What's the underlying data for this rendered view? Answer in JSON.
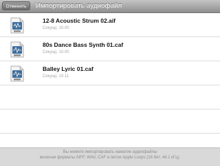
{
  "navbar": {
    "cancel_label": "Отменить",
    "title": "Импортировать аудиофайл"
  },
  "files": [
    {
      "name": "12-8 Acoustic Strum 02.aif",
      "subtitle": "Секунд: 10.00",
      "icon": "aif-file-icon"
    },
    {
      "name": "80s Dance Bass Synth 01.caf",
      "subtitle": "Секунд: 10.00",
      "icon": "caf-file-icon"
    },
    {
      "name": "Balley Lyric 01.caf",
      "subtitle": "Секунд: 10.11",
      "icon": "caf-file-icon"
    }
  ],
  "footer": {
    "line1": "Вы можете импортировать нажатие аудиофайлы",
    "line2": "включая форматы AIFF, WAV, CAF и петли Apple Loops (16 бит, 44.1 кГц)."
  },
  "colors": {
    "navbar_top": "#c4c4c4",
    "navbar_bottom": "#8e8e8e",
    "icon_accent": "#3f6f9e",
    "footer_bg": "#d9d9d9"
  }
}
